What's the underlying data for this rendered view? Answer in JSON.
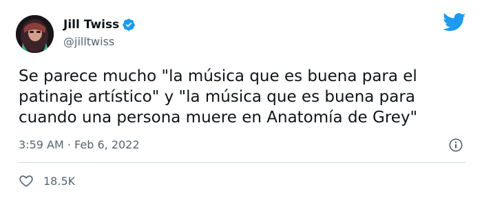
{
  "author": {
    "display_name": "Jill Twiss",
    "handle": "@jilltwiss",
    "verified": true
  },
  "tweet": {
    "text_lines": [
      "Se parece mucho \"la música que es buena para el",
      "patinaje artístico\" y \"la música que es buena para",
      "cuando una persona muere en Anatomía de Grey\""
    ],
    "time": "3:59 AM",
    "separator": "·",
    "date": "Feb 6, 2022",
    "likes": "18.5K"
  },
  "icons": {
    "verified": "verified-badge-icon",
    "brand": "twitter-bird-icon",
    "info": "info-icon",
    "like": "heart-icon"
  },
  "colors": {
    "brand_blue": "#1d9bf0",
    "text_primary": "#0f1419",
    "text_secondary": "#536471",
    "divider": "#cfd9de"
  }
}
